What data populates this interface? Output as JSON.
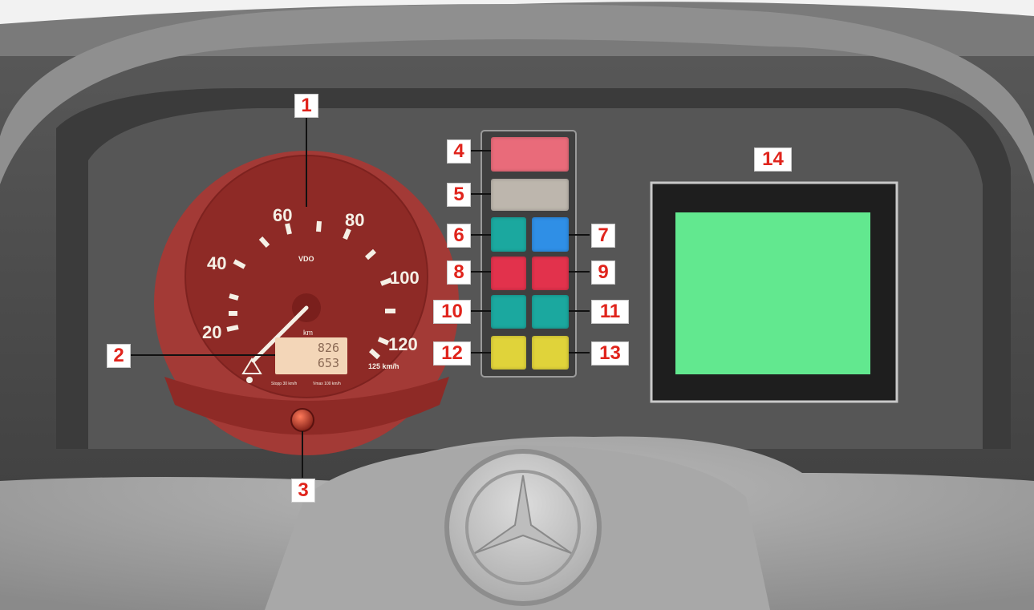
{
  "speedometer": {
    "brand": "VDO",
    "unit": "km/h",
    "odometer_unit": "km",
    "max_speed_label": "125 km/h",
    "tick_labels": [
      "20",
      "40",
      "60",
      "80",
      "100",
      "120"
    ],
    "odometer_total": "826",
    "trip": "653",
    "fine_print_left": "Stopp 30 km/h",
    "fine_print_right": "Vmax 100 km/h"
  },
  "callouts": [
    "1",
    "2",
    "3",
    "4",
    "5",
    "6",
    "7",
    "8",
    "9",
    "10",
    "11",
    "12",
    "13",
    "14"
  ],
  "lamp_colors": {
    "4": "#e96b7a",
    "5": "#bdb6ad",
    "6": "#1ba89f",
    "7": "#2f8fe6",
    "8": "#e2324c",
    "9": "#e2324c",
    "10": "#1ba89f",
    "11": "#1ba89f",
    "12": "#e0d33a",
    "13": "#e0d33a"
  },
  "display_color": "#62e88f",
  "gauge_face_color": "#8e2a26",
  "callout_text_color": "#e0241c"
}
